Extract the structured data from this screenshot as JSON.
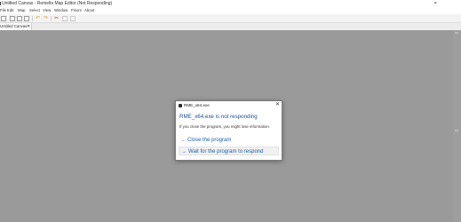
{
  "window": {
    "title": "Untitled Canvas - Remelts Map Editor (Not Responding)",
    "close_glyph": "✕"
  },
  "menubar": {
    "items": [
      "File",
      "Edit",
      "Map",
      "Select",
      "View",
      "Window",
      "Floors",
      "About"
    ]
  },
  "toolbar": {
    "icons": [
      "new-file-icon",
      "open-folder-icon",
      "save-icon",
      "save-as-icon",
      "undo-icon",
      "redo-icon",
      "cut-icon",
      "copy-icon",
      "paste-icon"
    ]
  },
  "tabs": [
    {
      "label": "Untitled Canvas",
      "close": "✕"
    }
  ],
  "dialog": {
    "title": "RME_x64.exe",
    "close_glyph": "✕",
    "heading": "RME_x64.exe is not responding",
    "message": "If you close the program, you might lose information.",
    "options": [
      {
        "arrow": "→",
        "label": "Close the program"
      },
      {
        "arrow": "→",
        "label": "Wait for the program to respond"
      }
    ]
  },
  "colors": {
    "canvas": "#9a9a9a",
    "accent": "#1f5fa8",
    "heading": "#1e4f8f"
  }
}
